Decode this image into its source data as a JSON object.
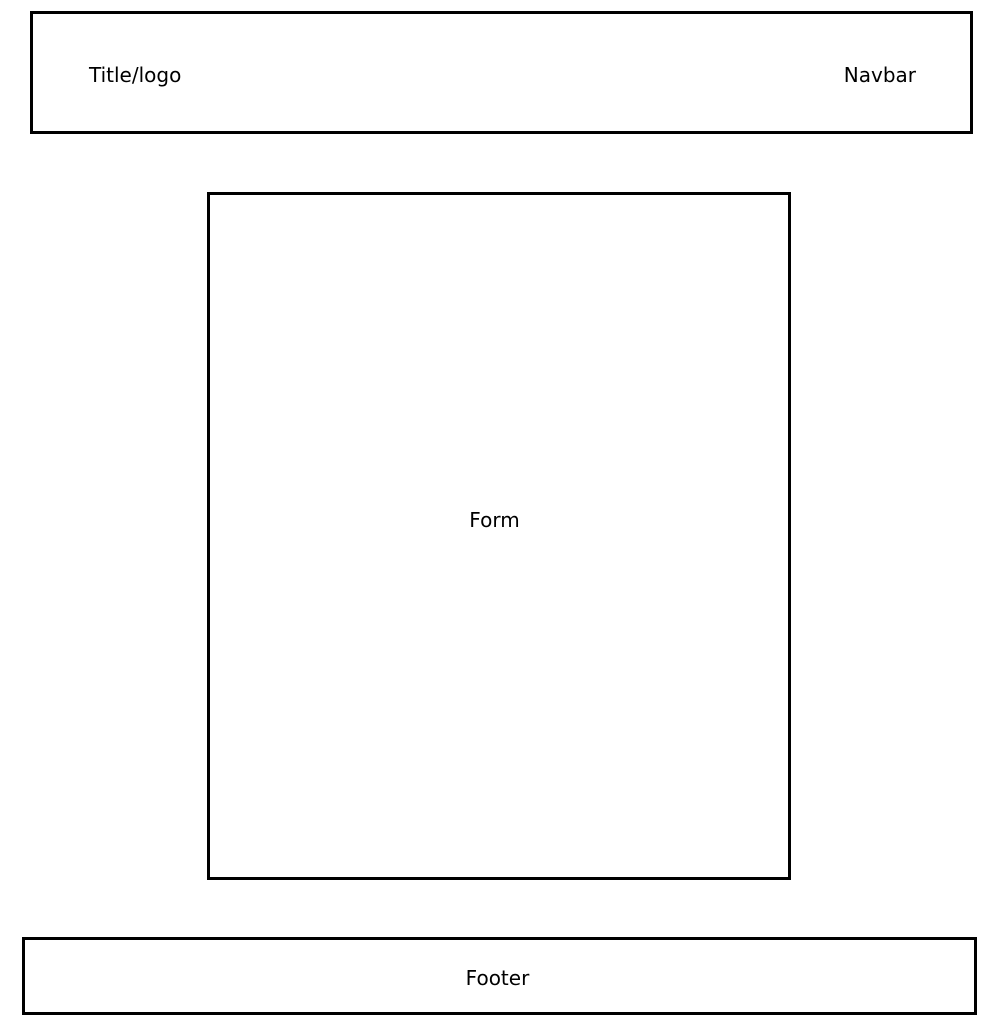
{
  "header": {
    "title_label": "Title/logo",
    "nav_label": "Navbar"
  },
  "main": {
    "form_label": "Form"
  },
  "footer": {
    "label": "Footer"
  },
  "colors": {
    "stroke": "#000000",
    "background": "#ffffff"
  }
}
